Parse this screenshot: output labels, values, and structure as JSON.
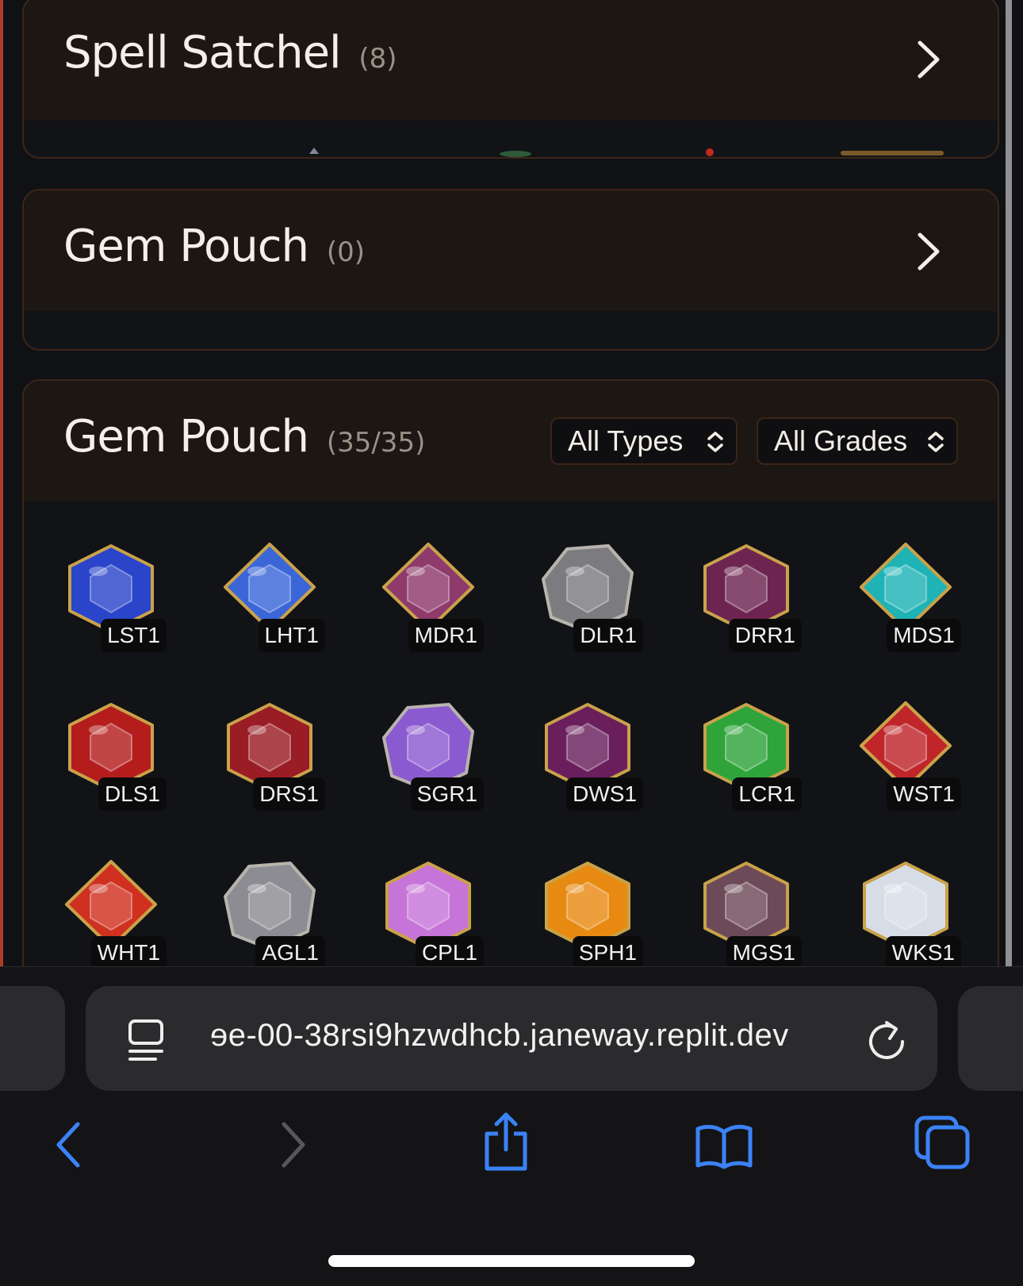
{
  "panels": {
    "spell_satchel": {
      "title": "Spell Satchel",
      "count": "(8)"
    },
    "gem_pouch_empty": {
      "title": "Gem Pouch",
      "count": "(0)"
    },
    "gem_pouch": {
      "title": "Gem Pouch",
      "count": "(35/35)",
      "type_filter": "All Types",
      "grade_filter": "All Grades"
    }
  },
  "gems": [
    {
      "code": "LST1",
      "color": "#2a45c9",
      "shape": "hex"
    },
    {
      "code": "LHT1",
      "color": "#3a66d8",
      "shape": "diamond"
    },
    {
      "code": "MDR1",
      "color": "#8e3a6b",
      "shape": "diamond"
    },
    {
      "code": "DLR1",
      "color": "#7c7c80",
      "shape": "rock"
    },
    {
      "code": "DRR1",
      "color": "#6d2450",
      "shape": "hex"
    },
    {
      "code": "MDS1",
      "color": "#1fb3b6",
      "shape": "diamond"
    },
    {
      "code": "DLS1",
      "color": "#b51d1d",
      "shape": "hex"
    },
    {
      "code": "DRS1",
      "color": "#9a1c24",
      "shape": "hex"
    },
    {
      "code": "SGR1",
      "color": "#8a5ad0",
      "shape": "rock"
    },
    {
      "code": "DWS1",
      "color": "#6a1f5c",
      "shape": "hex"
    },
    {
      "code": "LCR1",
      "color": "#2fa43a",
      "shape": "hex"
    },
    {
      "code": "WST1",
      "color": "#c0252a",
      "shape": "diamond"
    },
    {
      "code": "WHT1",
      "color": "#d03020",
      "shape": "diamond"
    },
    {
      "code": "AGL1",
      "color": "#8c8c92",
      "shape": "rock"
    },
    {
      "code": "CPL1",
      "color": "#c774d8",
      "shape": "hex"
    },
    {
      "code": "SPH1",
      "color": "#e88a12",
      "shape": "hex"
    },
    {
      "code": "MGS1",
      "color": "#6d4a58",
      "shape": "hex"
    },
    {
      "code": "WKS1",
      "color": "#d6dde6",
      "shape": "hex"
    }
  ],
  "browser": {
    "url": "ɘe-00-38rsi9hzwdhcb.janeway.replit.dev"
  },
  "icons": {
    "accent": "#3b82f6",
    "nav": [
      "back-icon",
      "forward-icon",
      "share-icon",
      "bookmarks-icon",
      "tabs-icon"
    ]
  }
}
